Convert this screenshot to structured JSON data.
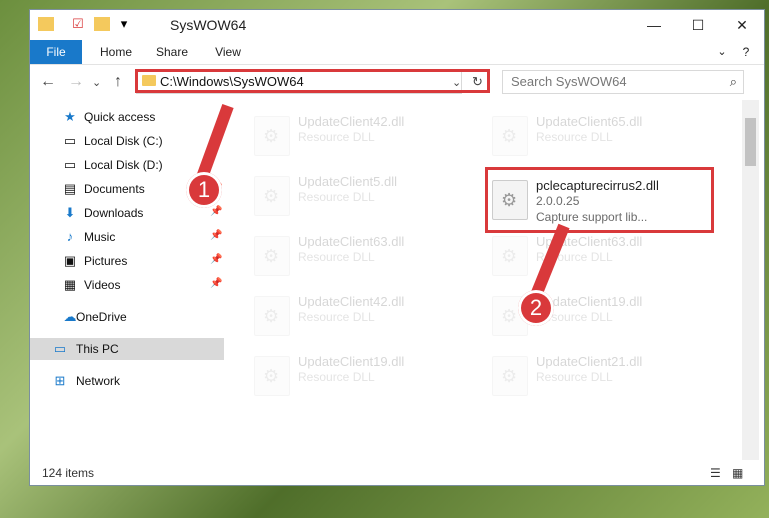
{
  "window": {
    "title": "SysWOW64",
    "ribbon_tabs": [
      "File",
      "Home",
      "Share",
      "View"
    ]
  },
  "address": {
    "path": "C:\\Windows\\SysWOW64"
  },
  "search": {
    "placeholder": "Search SysWOW64"
  },
  "sidebar": {
    "items": [
      {
        "label": "Quick access"
      },
      {
        "label": "Local Disk (C:)"
      },
      {
        "label": "Local Disk (D:)"
      },
      {
        "label": "Documents"
      },
      {
        "label": "Downloads"
      },
      {
        "label": "Music"
      },
      {
        "label": "Pictures"
      },
      {
        "label": "Videos"
      },
      {
        "label": "OneDrive"
      },
      {
        "label": "This PC"
      },
      {
        "label": "Network"
      }
    ]
  },
  "files": {
    "highlighted": {
      "name": "pclecapturecirrus2.dll",
      "version": "2.0.0.25",
      "description": "Capture support lib..."
    },
    "left": [
      {
        "name": "UpdateClient42.dll",
        "type": "Resource DLL"
      },
      {
        "name": "UpdateClient5.dll",
        "type": "Resource DLL"
      },
      {
        "name": "UpdateClient63.dll",
        "type": "Resource DLL"
      },
      {
        "name": "UpdateClient42.dll",
        "type": "Resource DLL"
      },
      {
        "name": "UpdateClient19.dll",
        "type": "Resource DLL"
      }
    ],
    "right": [
      {
        "name": "UpdateClient65.dll",
        "type": "Resource DLL"
      },
      {
        "name": "UpdateClient63.dll",
        "type": "Resource DLL"
      },
      {
        "name": "UpdateClient19.dll",
        "type": "Resource DLL"
      },
      {
        "name": "UpdateClient21.dll",
        "type": "Resource DLL"
      }
    ]
  },
  "status": {
    "items": "124 items"
  },
  "annotations": {
    "step1": "1",
    "step2": "2"
  }
}
